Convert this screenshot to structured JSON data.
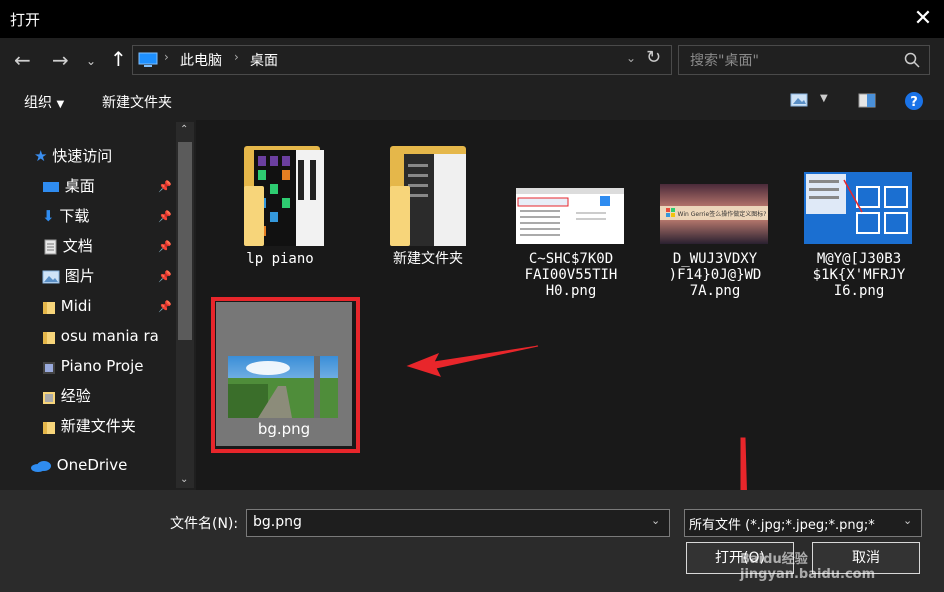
{
  "window": {
    "title": "打开"
  },
  "address": {
    "segments": [
      "此电脑",
      "桌面"
    ]
  },
  "search": {
    "placeholder": "搜索\"桌面\""
  },
  "toolbar": {
    "organize": "组织",
    "new_folder": "新建文件夹"
  },
  "sidebar": {
    "items": [
      {
        "label": "快速访问",
        "icon": "star-icon"
      },
      {
        "label": "桌面",
        "icon": "desktop-icon"
      },
      {
        "label": "下载",
        "icon": "download-icon"
      },
      {
        "label": "文档",
        "icon": "document-icon"
      },
      {
        "label": "图片",
        "icon": "picture-icon"
      },
      {
        "label": "Midi",
        "icon": "folder-icon"
      },
      {
        "label": "osu mania ra",
        "icon": "folder-icon"
      },
      {
        "label": "Piano Proje",
        "icon": "folder-icon"
      },
      {
        "label": "经验",
        "icon": "folder-icon"
      },
      {
        "label": "新建文件夹",
        "icon": "folder-icon"
      },
      {
        "label": "OneDrive",
        "icon": "cloud-icon"
      }
    ]
  },
  "files": [
    {
      "label": "lp piano",
      "kind": "folder"
    },
    {
      "label": "新建文件夹",
      "kind": "folder"
    },
    {
      "label": "C~SHC$7K0DFAI00V55TIHH0.png",
      "line1": "C~SHC$7K0D",
      "line2": "FAI00V55TIH",
      "line3": "H0.png",
      "kind": "image"
    },
    {
      "label": "D_WUJ3VDXY)F14}0J@)WD7A.png",
      "line1": "D_WUJ3VDXY",
      "line2": ")F14}0J@}WD",
      "line3": "7A.png",
      "kind": "image"
    },
    {
      "label": "M@Y@[J30B3$1KCX'MFRJYI6.png",
      "line1": "M@Y@[J30B3",
      "line2": "$1K{X'MFRJY",
      "line3": "I6.png",
      "kind": "image"
    },
    {
      "label": "bg.png",
      "kind": "image",
      "selected": true
    }
  ],
  "thumb_text": {
    "windows_banner": "Win Gerrie签么操作做定义图标?"
  },
  "bottom": {
    "filename_label": "文件名(N):",
    "filename_value": "bg.png",
    "filetype_value": "所有文件 (*.jpg;*.jpeg;*.png;*",
    "open_button": "打开(O)",
    "cancel_button": "取消"
  },
  "watermark": {
    "text": "Baidu经验 jingyan.baidu.com"
  },
  "colors": {
    "accent_red": "#e8262b",
    "folder": "#f7d57a",
    "help_blue": "#1a73e8"
  }
}
